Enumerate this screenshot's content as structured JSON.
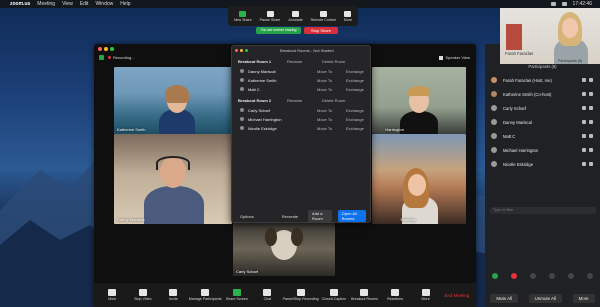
{
  "menubar": {
    "apple": "",
    "items": [
      "zoom.us",
      "Meeting",
      "View",
      "Edit",
      "Window",
      "Help"
    ],
    "clock": "17:42:46"
  },
  "share_toolbar": {
    "items": [
      {
        "label": "New Share",
        "icon": "share-icon",
        "color": "#2bb24c"
      },
      {
        "label": "Pause Share",
        "icon": "pause-icon",
        "color": "#e6e6e6"
      },
      {
        "label": "Annotate",
        "icon": "annotate-icon",
        "color": "#e6e6e6"
      },
      {
        "label": "Remote Control",
        "icon": "remote-icon",
        "color": "#e6e6e6"
      },
      {
        "label": "More",
        "icon": "more-icon",
        "color": "#e6e6e6"
      }
    ],
    "sharing_status": "You are screen sharing",
    "stop_label": "Stop Share"
  },
  "zoom_window": {
    "recording_label": "Recording...",
    "view_label": "Speaker View",
    "tiles": [
      {
        "name": "Katherine Smith"
      },
      {
        "name": "Harrington"
      },
      {
        "name": "Danny Mariscal"
      },
      {
        "name": "Eskridge"
      },
      {
        "name": "Carly Scharf"
      }
    ],
    "toolbar": [
      {
        "label": "Mute",
        "icon": "microphone-icon"
      },
      {
        "label": "Stop Video",
        "icon": "camera-icon"
      },
      {
        "label": "Invite",
        "icon": "invite-icon"
      },
      {
        "label": "Manage Participants",
        "icon": "participants-icon"
      },
      {
        "label": "Share Screen",
        "icon": "share-screen-icon"
      },
      {
        "label": "Chat",
        "icon": "chat-icon"
      },
      {
        "label": "Pause/Stop Recording",
        "icon": "record-icon"
      },
      {
        "label": "Closed Caption",
        "icon": "cc-icon"
      },
      {
        "label": "Breakout Rooms",
        "icon": "breakout-icon"
      },
      {
        "label": "Reactions",
        "icon": "reactions-icon"
      },
      {
        "label": "More",
        "icon": "more-icon"
      }
    ],
    "end_label": "End Meeting"
  },
  "breakout": {
    "title": "Breakout Rooms - Not Started",
    "rooms": [
      {
        "name": "Breakout Room 1",
        "rename": "Rename",
        "delete": "Delete Room",
        "members": [
          "Danny Mariscal",
          "Katherine Smith",
          "Matt C"
        ]
      },
      {
        "name": "Breakout Room 2",
        "rename": "Rename",
        "delete": "Delete Room",
        "members": [
          "Carly Scharf",
          "Michael Harrington",
          "Nicolle Eskridge"
        ]
      }
    ],
    "move_to": "Move To",
    "exchange": "Exchange",
    "options_label": "Options",
    "recreate_label": "Recreate",
    "add_room_label": "Add a Room",
    "open_all_label": "Open All Rooms"
  },
  "participants": {
    "title": "Participants (6)",
    "list": [
      {
        "name": "Farah Faraclas (Host, me)"
      },
      {
        "name": "Katherine Smith (Co-host)"
      },
      {
        "name": "Carly Scharf"
      },
      {
        "name": "Danny Mariscal"
      },
      {
        "name": "Matt C"
      },
      {
        "name": "Michael Harrington"
      },
      {
        "name": "Nicolle Eskridge"
      }
    ],
    "search_placeholder": "Type to filter",
    "mute_all": "Mute All",
    "unmute_all": "Unmute All",
    "more": "More"
  },
  "self_video": {
    "name": "Farah Faraclas",
    "caption": "Participants (6)"
  }
}
